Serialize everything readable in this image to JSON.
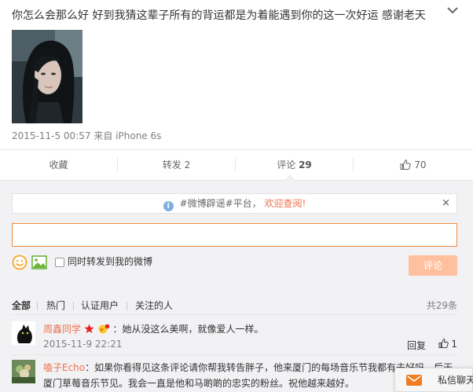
{
  "post": {
    "text": "你怎么会那么好 好到我猜这辈子所有的背运都是为着能遇到你的这一次好运 感谢老天",
    "time": "2015-11-5 00:57",
    "from_prefix": "来自",
    "source": "iPhone 6s"
  },
  "actions": {
    "favorite": "收藏",
    "repost": "转发 2",
    "comment_label": "评论",
    "comment_count": "29",
    "like_count": "70"
  },
  "notice": {
    "text": "#微博辟谣#平台，",
    "link": "欢迎查阅!",
    "close": "×"
  },
  "composer": {
    "input_value": "",
    "repost_label": "同时转发到我的微博",
    "submit": "评论"
  },
  "filters": {
    "items": [
      "全部",
      "热门",
      "认证用户",
      "关注的人"
    ],
    "total": "共29条"
  },
  "comments": [
    {
      "user": "周鑫同学",
      "text": "：她从没这么美啊，就像爱人一样。",
      "time": "2015-11-9 22:21",
      "reply": "回复",
      "likes": "1"
    },
    {
      "user": "嗑子Echo",
      "text_line1": "：如果你看得见这条评论请你帮我转告胖子，他来厦门的每场音乐节我都有去好吗，后天",
      "text_line2": "厦门草莓音乐节见。我会一直是他和马啲啲的忠实的粉丝。祝他越来越好。"
    }
  ],
  "pm": {
    "label": "私信聊天"
  },
  "colors": {
    "accent": "#eb7350",
    "submit_disabled": "#ffc09f",
    "input_border": "#f08c3c",
    "comment_bg": "#f2f2f5"
  }
}
